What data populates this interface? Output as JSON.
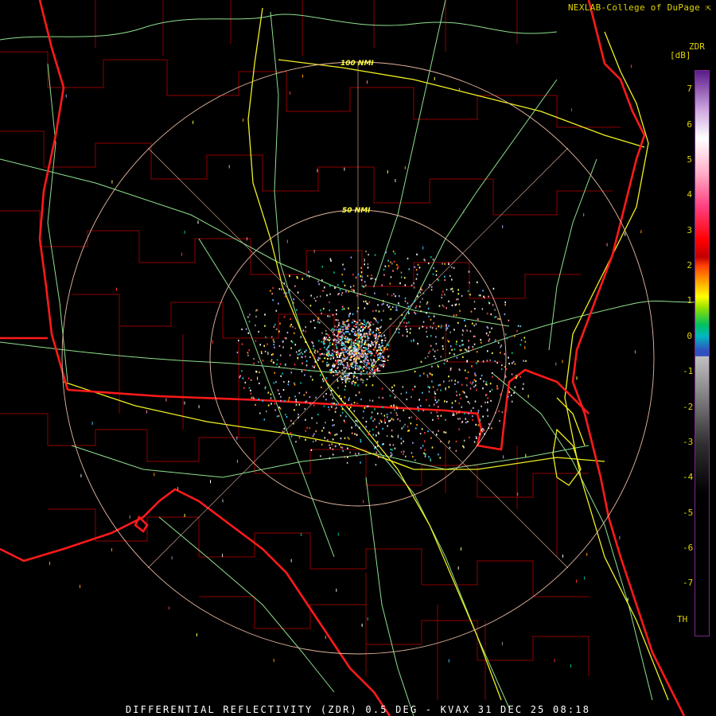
{
  "credit": "NEXLAB-College of DuPage",
  "credit_icon": "cursor-arrow-icon",
  "caption": "DIFFERENTIAL REFLECTIVITY (ZDR) 0.5 DEG - KVAX 31 DEC 25 08:18",
  "range_rings": [
    "100 NMI",
    "50 NMI"
  ],
  "legend": {
    "title": "ZDR",
    "unit": "[dB]",
    "ticks": [
      "7",
      "6",
      "5",
      "4",
      "3",
      "2",
      "1",
      "0",
      "-1",
      "-2",
      "-3",
      "-4",
      "-5",
      "-6",
      "-7"
    ],
    "threshold_label": "TH"
  },
  "colors": {
    "state_borders": "#ff1a1a",
    "county_lines": "#b00000",
    "highways": "#ffff33",
    "roads": "#90e090",
    "range_rings": "#f0c8a8",
    "labels": "#e0d400"
  }
}
